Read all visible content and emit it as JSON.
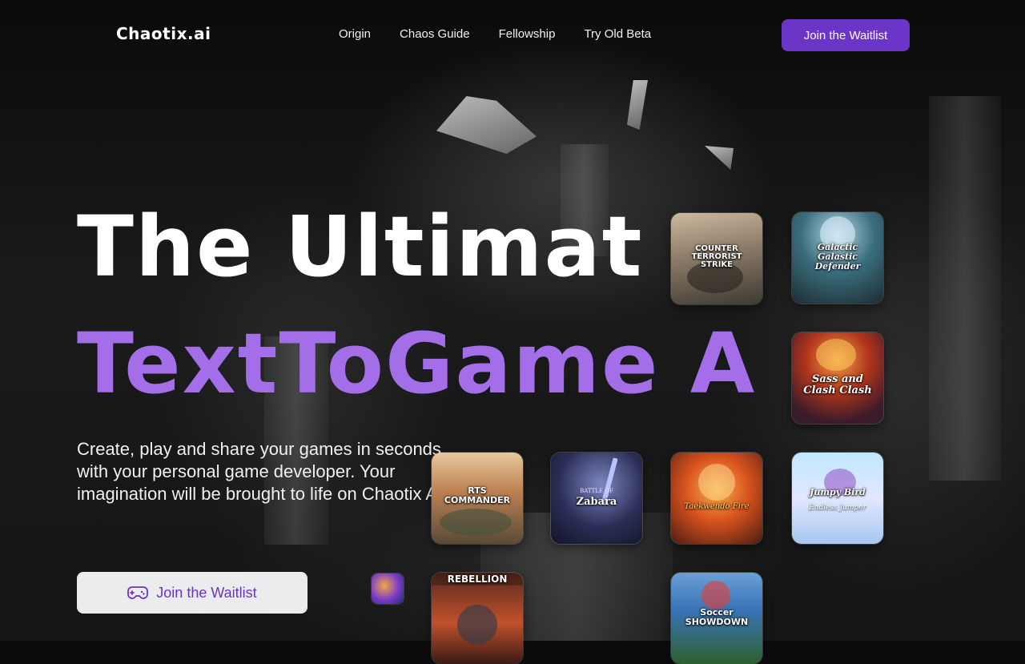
{
  "nav": {
    "logo": "Chaotix.ai",
    "links": [
      "Origin",
      "Chaos Guide",
      "Fellowship",
      "Try Old Beta"
    ],
    "cta_label": "Join the Waitlist"
  },
  "hero": {
    "headline_line1": "The Ultimat",
    "headline_line2": "TextToGame A",
    "subtitle": "Create, play and share your games in seconds with your personal game developer. Your imagination will be brought to life on Chaotix AI.",
    "cta_label": "Join the Waitlist",
    "cta_icon": "gamepad-icon"
  },
  "games": [
    {
      "title": "COUNTER TERRORIST STRIKE",
      "tagline": ""
    },
    {
      "title": "Galactic Galastic Defender",
      "tagline": ""
    },
    {
      "title": "Sass and Clash Clash",
      "tagline": ""
    },
    {
      "title": "RTS COMMANDER",
      "tagline": ""
    },
    {
      "title": "Zabara",
      "tagline": "BATTLE OF"
    },
    {
      "title": "Taekwendo Fire",
      "tagline": ""
    },
    {
      "title": "Jumpy Bird",
      "tagline": "Endless Jumper"
    },
    {
      "title": "REBELLION",
      "tagline": ""
    },
    {
      "title": "Soccer SHOWDOWN",
      "tagline": ""
    }
  ],
  "colors": {
    "accent": "#6b35c7",
    "headline_accent": "#a46ee8",
    "background": "#0c0c0e"
  }
}
